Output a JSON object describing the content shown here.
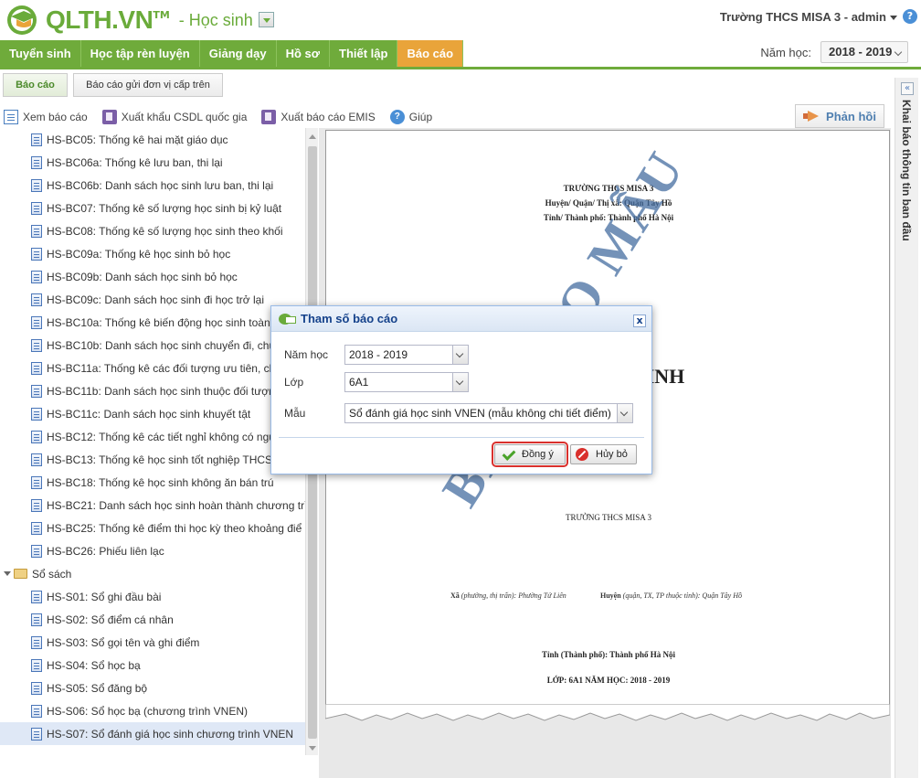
{
  "header": {
    "logo_text": "QLTH.VN",
    "logo_tm": "TM",
    "module": "- Học sinh",
    "user": "Trường THCS MISA 3 - admin",
    "help_glyph": "?"
  },
  "nav": {
    "tabs": [
      "Tuyển sinh",
      "Học tập rèn luyện",
      "Giảng dạy",
      "Hồ sơ",
      "Thiết lập",
      "Báo cáo"
    ],
    "active_tab": "Báo cáo",
    "school_year_label": "Năm học:",
    "school_year_value": "2018 - 2019",
    "brand_color": "#6fab3b",
    "active_color": "#e9a43a"
  },
  "subtabs": {
    "report": "Báo cáo",
    "report_upper": "Báo cáo gửi đơn vị cấp trên"
  },
  "toolbar": {
    "view": "Xem báo cáo",
    "export_db": "Xuất khẩu CSDL quốc gia",
    "export_emis": "Xuất báo cáo EMIS",
    "help": "Giúp",
    "feedback": "Phản hồi"
  },
  "tree": {
    "items": [
      {
        "label": "HS-BC05: Thống kê hai mặt giáo dục",
        "type": "leaf"
      },
      {
        "label": "HS-BC06a: Thống kê lưu ban, thi lại",
        "type": "leaf"
      },
      {
        "label": "HS-BC06b: Danh sách học sinh lưu ban, thi lại",
        "type": "leaf"
      },
      {
        "label": "HS-BC07: Thống kê số lượng học sinh bị kỷ luật",
        "type": "leaf"
      },
      {
        "label": "HS-BC08: Thống kê số lượng học sinh theo khối",
        "type": "leaf"
      },
      {
        "label": "HS-BC09a: Thống kê học sinh bỏ học",
        "type": "leaf"
      },
      {
        "label": "HS-BC09b: Danh sách học sinh bỏ học",
        "type": "leaf"
      },
      {
        "label": "HS-BC09c: Danh sách học sinh đi học trở lại",
        "type": "leaf"
      },
      {
        "label": "HS-BC10a: Thống kê biến động học sinh toàn",
        "type": "leaf"
      },
      {
        "label": "HS-BC10b: Danh sách học sinh chuyển đi, chu",
        "type": "leaf"
      },
      {
        "label": "HS-BC11a: Thống kê các đối tượng ưu tiên, ch",
        "type": "leaf"
      },
      {
        "label": "HS-BC11b: Danh sách học sinh thuộc đối tượn",
        "type": "leaf"
      },
      {
        "label": "HS-BC11c: Danh sách học sinh khuyết tật",
        "type": "leaf"
      },
      {
        "label": "HS-BC12: Thống kê các tiết nghỉ không có ngư",
        "type": "leaf"
      },
      {
        "label": "HS-BC13: Thống kê học sinh tốt nghiệp THCS",
        "type": "leaf"
      },
      {
        "label": "HS-BC18: Thống kê học sinh không ăn bán trú",
        "type": "leaf"
      },
      {
        "label": "HS-BC21: Danh sách học sinh hoàn thành chương trìr",
        "type": "leaf"
      },
      {
        "label": "HS-BC25: Thống kê điểm thi học kỳ theo khoảng điể",
        "type": "leaf"
      },
      {
        "label": "HS-BC26: Phiếu liên lạc",
        "type": "leaf"
      },
      {
        "label": "Sổ sách",
        "type": "folder"
      },
      {
        "label": "HS-S01: Sổ ghi đầu bài",
        "type": "leaf"
      },
      {
        "label": "HS-S02: Sổ điểm cá nhân",
        "type": "leaf"
      },
      {
        "label": "HS-S03: Sổ gọi tên và ghi điểm",
        "type": "leaf"
      },
      {
        "label": "HS-S04: Sổ học bạ",
        "type": "leaf"
      },
      {
        "label": "HS-S05: Sổ đăng bộ",
        "type": "leaf"
      },
      {
        "label": "HS-S06: Sổ học bạ (chương trình VNEN)",
        "type": "leaf"
      },
      {
        "label": "HS-S07: Sổ đánh giá học sinh chương trình VNEN",
        "type": "leaf",
        "selected": true
      }
    ]
  },
  "preview": {
    "school": "TRƯỜNG THCS MISA 3",
    "district": "Huyện/ Quận/ Thị xã: Quận Tây Hồ",
    "province": "Tỉnh/ Thành phố: Thành phố Hà Nội",
    "title_fragment": "ỌC SINH",
    "watermark": "BÁO CÁO MẪU",
    "school2": "TRƯỜNG THCS MISA 3",
    "commune_label": "Xã",
    "commune_hint": "(phường, thị trấn):",
    "commune_value": "Phường Tứ Liên",
    "district_label": "Huyện",
    "district_hint": "(quận, TX, TP thuộc tỉnh):",
    "district_value": "Quận Tây Hồ",
    "province2": "Tỉnh (Thành phố): Thành phố Hà Nội",
    "class_year": "LỚP: 6A1  NĂM HỌC: 2018 - 2019"
  },
  "side_panel": {
    "toggle": "«",
    "label": "Khai báo thông tin ban đầu"
  },
  "dialog": {
    "title": "Tham số báo cáo",
    "close": "x",
    "school_year_label": "Năm học",
    "school_year_value": "2018 - 2019",
    "class_label": "Lớp",
    "class_value": "6A1",
    "template_label": "Mẫu",
    "template_value": "Sổ đánh giá học sinh VNEN (mẫu không chi tiết điểm)",
    "ok": "Đồng ý",
    "cancel": "Hủy bỏ"
  }
}
